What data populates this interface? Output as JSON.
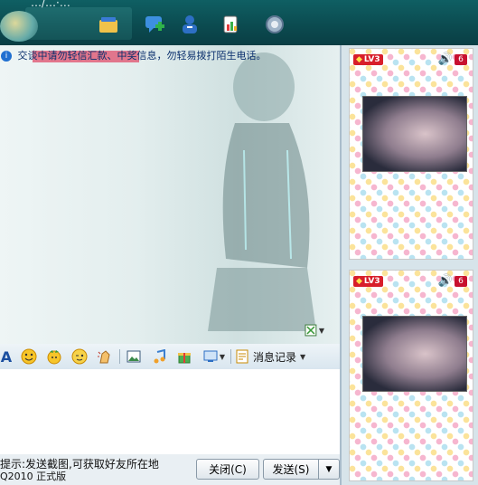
{
  "window": {
    "title": "…/…·…"
  },
  "toolbar": {
    "icons": [
      "contact-icon",
      "chat-add-icon",
      "user-info-icon",
      "apps-icon",
      "settings-icon"
    ]
  },
  "chat": {
    "notice": "交谈中请勿轻信汇款、中奖信息，勿轻易拨打陌生电话。"
  },
  "format_toolbar": {
    "font_glyph": "A",
    "history_label": "消息记录"
  },
  "bottom": {
    "tip": "提示:发送截图,可获取好友所在地",
    "version": "Q2010 正式版",
    "close_label": "关闭(C)",
    "send_label": "发送(S)"
  },
  "profile_cards": [
    {
      "level": "LV3",
      "count": "6"
    },
    {
      "level": "LV3",
      "count": "6"
    }
  ]
}
